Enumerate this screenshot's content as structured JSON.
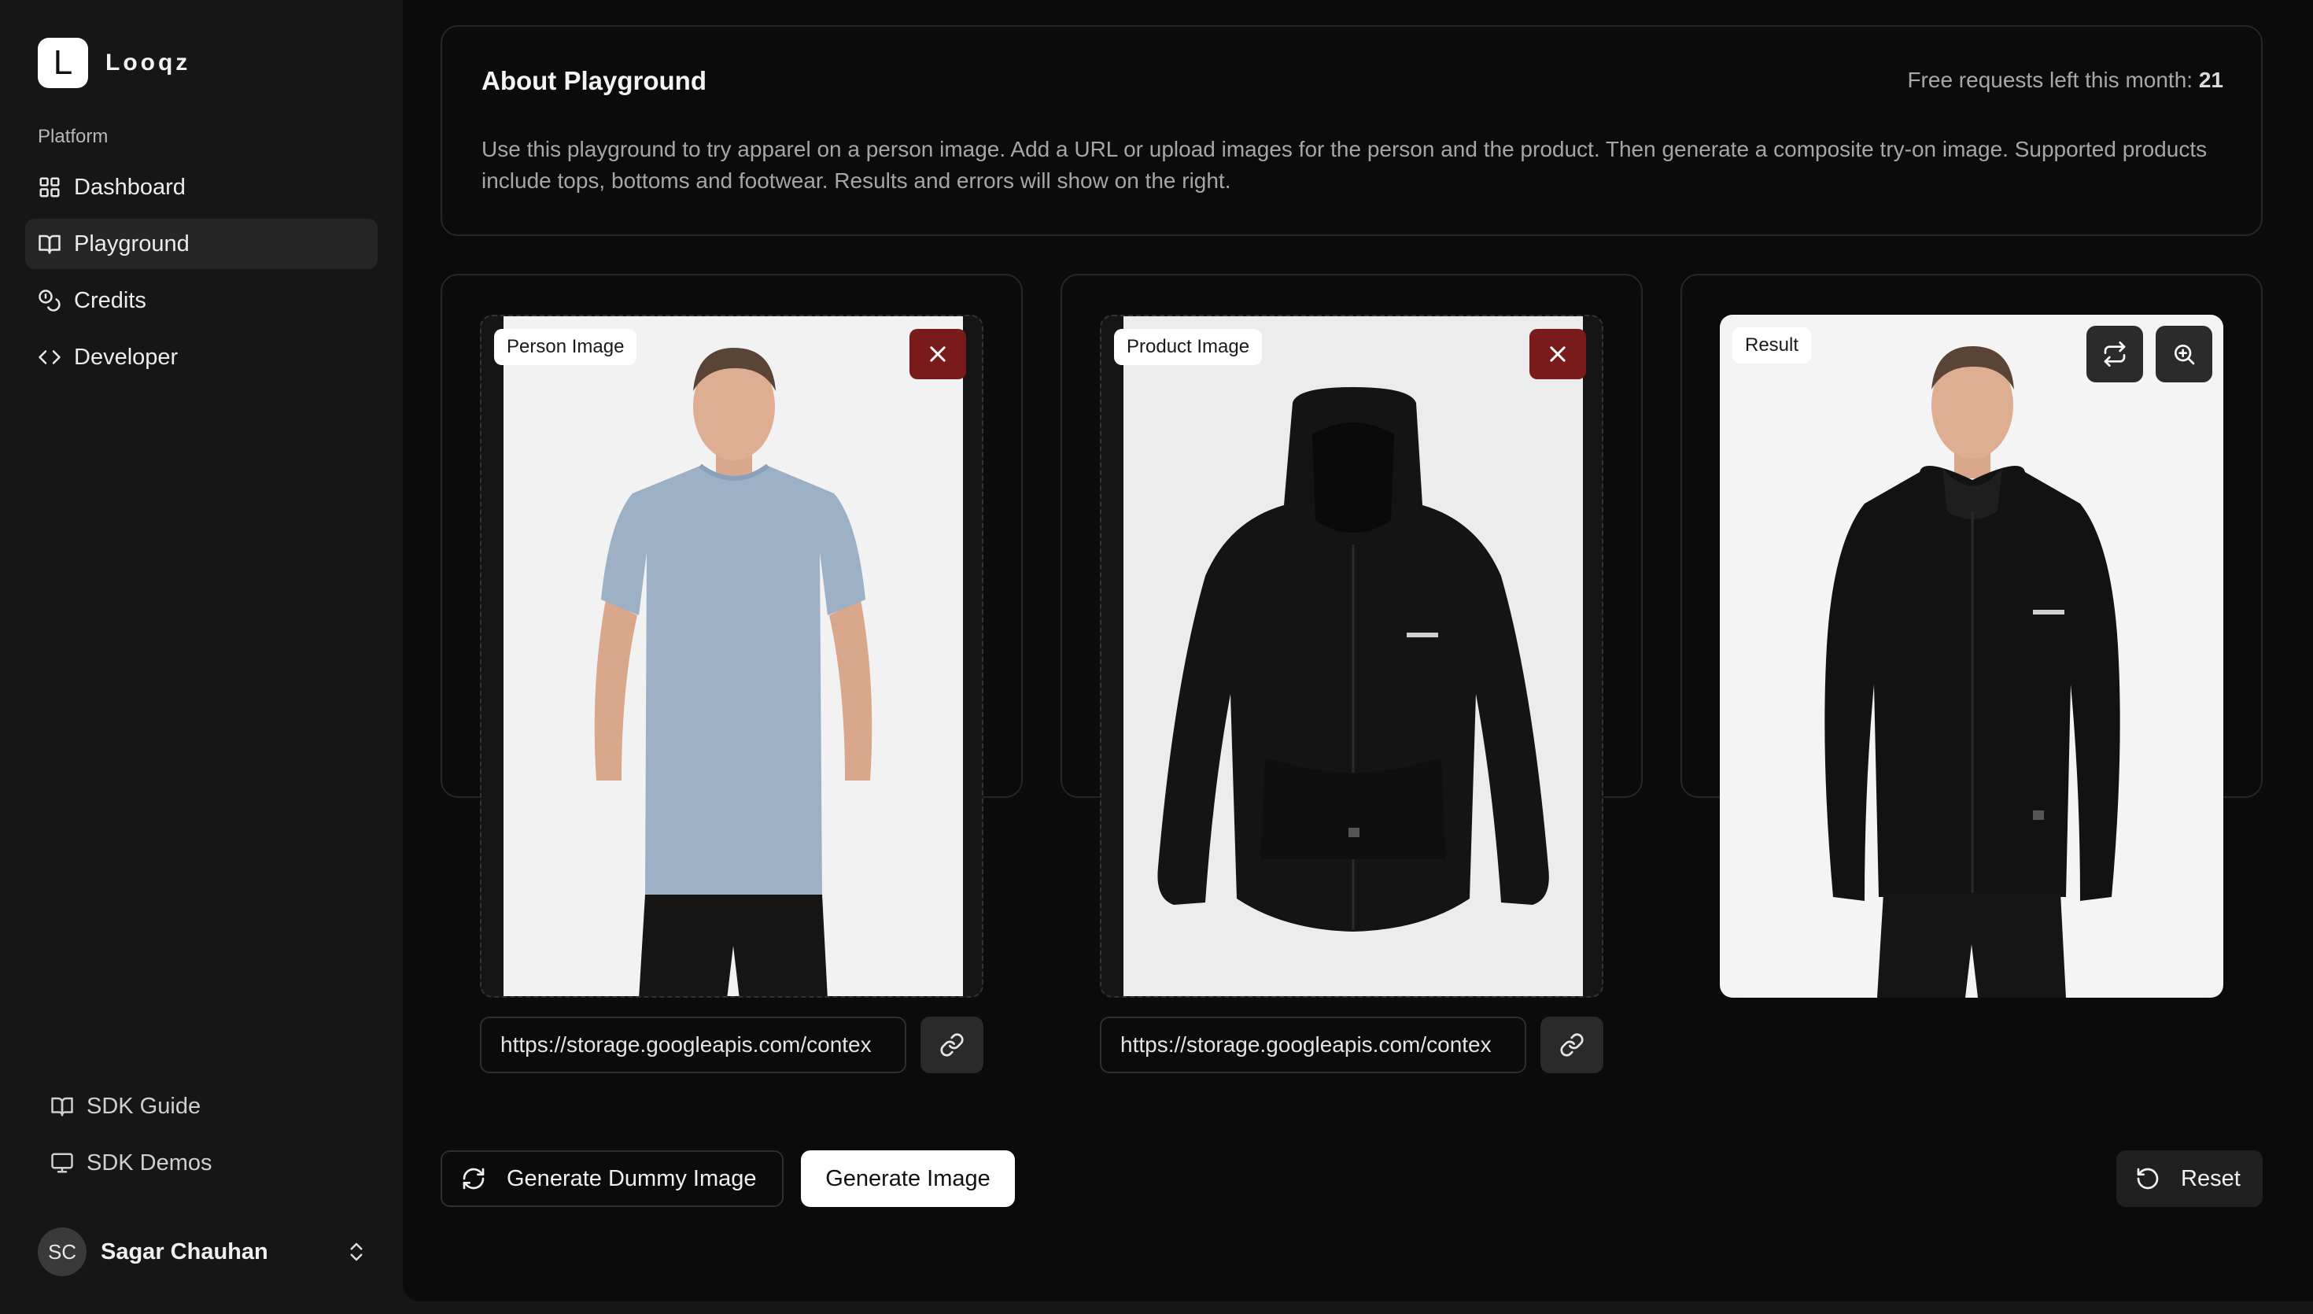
{
  "brand": {
    "logo_letter": "L",
    "name": "Looqz"
  },
  "sidebar": {
    "section_label": "Platform",
    "items": [
      {
        "label": "Dashboard",
        "icon": "grid-icon",
        "active": false
      },
      {
        "label": "Playground",
        "icon": "book-icon",
        "active": true
      },
      {
        "label": "Credits",
        "icon": "coins-icon",
        "active": false
      },
      {
        "label": "Developer",
        "icon": "code-icon",
        "active": false
      }
    ],
    "bottom_items": [
      {
        "label": "SDK Guide",
        "icon": "book-icon"
      },
      {
        "label": "SDK Demos",
        "icon": "monitor-icon"
      }
    ],
    "user": {
      "initials": "SC",
      "name": "Sagar Chauhan"
    }
  },
  "about": {
    "title": "About Playground",
    "quota_label": "Free requests left this month:",
    "quota_value": "21",
    "description": "Use this playground to try apparel on a person image. Add a URL or upload images for the person and the product. Then generate a composite try-on image. Supported products include tops, bottoms and footwear. Results and errors will show on the right."
  },
  "panels": {
    "person": {
      "tag": "Person Image",
      "url": "https://storage.googleapis.com/contex"
    },
    "product": {
      "tag": "Product Image",
      "url": "https://storage.googleapis.com/contex"
    },
    "result": {
      "tag": "Result"
    }
  },
  "actions": {
    "dummy_label": "Generate Dummy Image",
    "generate_label": "Generate Image",
    "reset_label": "Reset"
  },
  "colors": {
    "main_bg": "#0b0b0b",
    "sidebar_bg": "#161616",
    "remove_button": "#7a1b1b",
    "tshirt": "#9cb0c6",
    "hoodie": "#141414"
  }
}
